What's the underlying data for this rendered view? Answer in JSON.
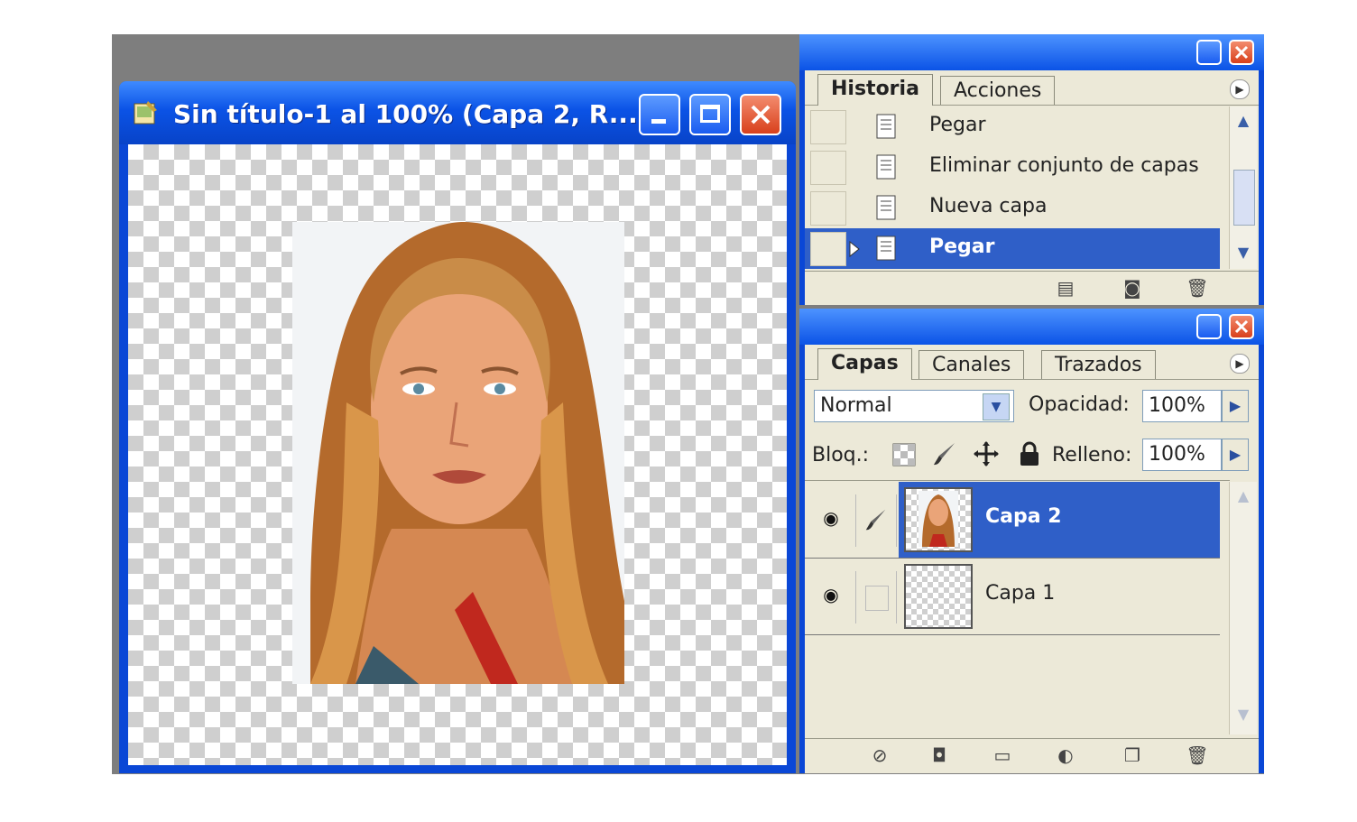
{
  "document": {
    "title": "Sin título-1 al 100% (Capa 2, R...",
    "buttons": {
      "minimize": "minimize",
      "maximize": "maximize",
      "close": "close"
    }
  },
  "history_panel": {
    "tabs": [
      "Historia",
      "Acciones"
    ],
    "active_tab": "Historia",
    "items": [
      {
        "label": "Pegar",
        "selected": false
      },
      {
        "label": "Eliminar conjunto de capas",
        "selected": false
      },
      {
        "label": "Nueva capa",
        "selected": false
      },
      {
        "label": "Pegar",
        "selected": true
      }
    ]
  },
  "layers_panel": {
    "tabs": [
      "Capas",
      "Canales",
      "Trazados"
    ],
    "active_tab": "Capas",
    "blend_mode": "Normal",
    "opacity_label": "Opacidad:",
    "opacity_value": "100%",
    "lock_label": "Bloq.:",
    "fill_label": "Relleno:",
    "fill_value": "100%",
    "layers": [
      {
        "name": "Capa 2",
        "selected": true,
        "visible": true
      },
      {
        "name": "Capa 1",
        "selected": false,
        "visible": true
      }
    ]
  },
  "colors": {
    "title_blue": "#0b53e6",
    "selection_blue": "#2f5fc8",
    "panel_bg": "#ece9d8",
    "close_red": "#d8401c"
  }
}
